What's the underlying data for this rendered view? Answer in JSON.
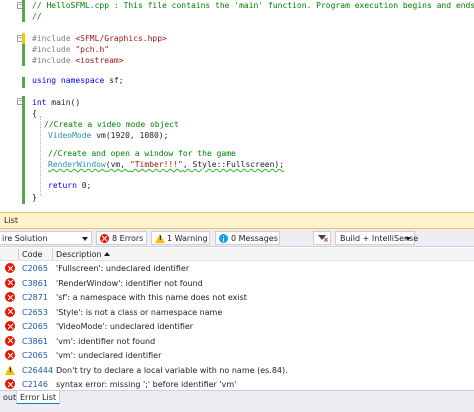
{
  "editor": {
    "lines": {
      "l1a": "// HelloSFML.cpp : This file contains the 'main' function. Program execution begins and ends there.",
      "l2": "//",
      "inc1_kw": "#include",
      "inc1_path": "<SFML/Graphics.hpp>",
      "inc2_kw": "#include",
      "inc2_path": "\"pch.h\"",
      "inc3_kw": "#include",
      "inc3_path": "<iostream>",
      "using_kw1": "using",
      "using_kw2": "namespace",
      "using_rest": "sf;",
      "main_kw": "int",
      "main_rest": "main()",
      "brace_open": "{",
      "cmt1": "//Create a video mode object",
      "vm_type": "VideoMode",
      "vm_rest": "vm(1920, 1080);",
      "cmt2": "//Create and open a window for the game",
      "rw_type": "RenderWindow",
      "rw_a": "(vm, ",
      "rw_str": "\"Timber!!!\"",
      "rw_b": ", Style::Fullscreen);",
      "ret_kw": "return",
      "ret_rest": "0;",
      "brace_close": "}"
    }
  },
  "panel": {
    "title": "List",
    "scope": "ire Solution",
    "errors_label": "8 Errors",
    "warning_label": "1 Warning",
    "messages_label": "0 Messages",
    "build_label": "Build + IntelliSense",
    "headers": {
      "code": "Code",
      "description": "Description"
    },
    "rows": [
      {
        "type": "error",
        "code": "C2065",
        "description": "'Fullscreen': undeclared identifier"
      },
      {
        "type": "error",
        "code": "C3861",
        "description": "'RenderWindow': identifier not found"
      },
      {
        "type": "error",
        "code": "C2871",
        "description": "'sf': a namespace with this name does not exist"
      },
      {
        "type": "error",
        "code": "C2653",
        "description": "'Style': is not a class or namespace name"
      },
      {
        "type": "error",
        "code": "C2065",
        "description": "'VideoMode': undeclared identifier"
      },
      {
        "type": "error",
        "code": "C3861",
        "description": "'vm': identifier not found"
      },
      {
        "type": "error",
        "code": "C2065",
        "description": "'vm': undeclared identifier"
      },
      {
        "type": "warning",
        "code": "C26444",
        "description": "Don't try to declare a local variable with no name (es.84)."
      },
      {
        "type": "error",
        "code": "C2146",
        "description": "syntax error: missing ';' before identifier 'vm'"
      }
    ]
  },
  "bottom_tabs": {
    "output": "out",
    "error_list": "Error List"
  },
  "colors": {
    "error": "#e51400",
    "warning": "#f2c200",
    "info": "#1ba1e2",
    "accent": "#007acc",
    "panel_title_bg": "#fff2cc"
  },
  "icons": {
    "error": "error-circle-icon",
    "warning": "warning-triangle-icon",
    "info": "info-circle-icon",
    "filter": "filter-clear-icon"
  }
}
